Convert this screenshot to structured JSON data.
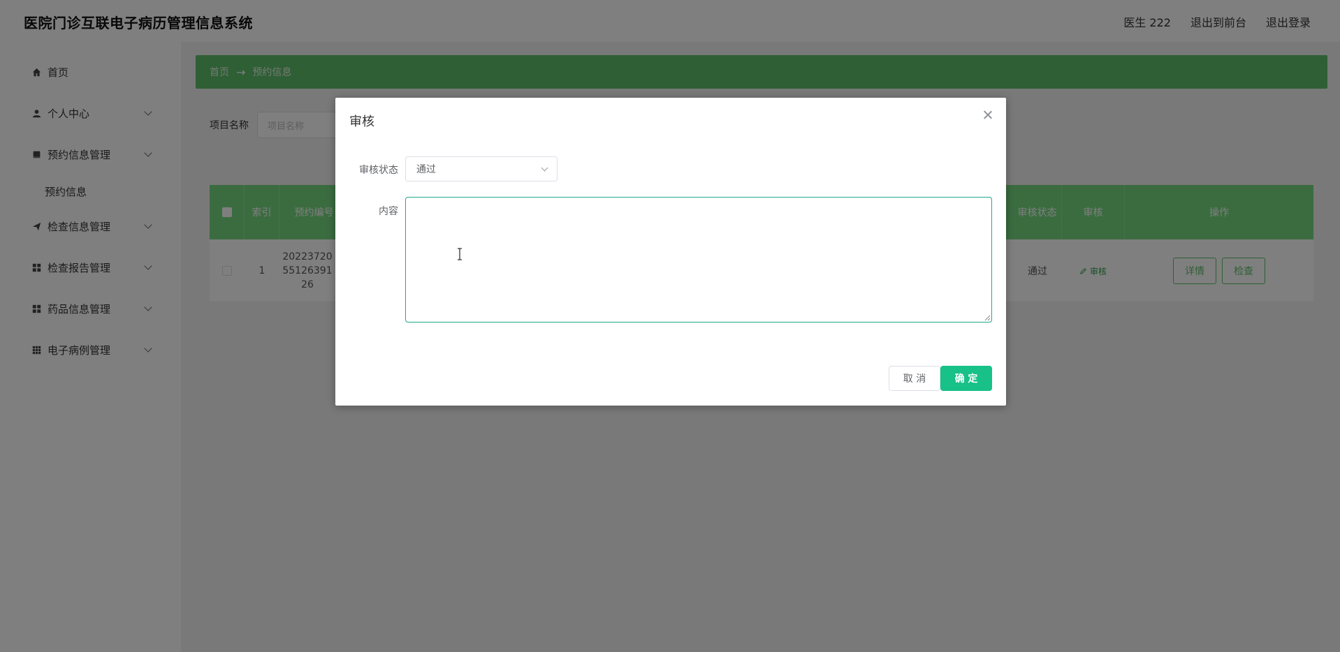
{
  "header": {
    "title": "医院门诊互联电子病历管理信息系统",
    "user": "医生 222",
    "to_frontend": "退出到前台",
    "logout": "退出登录"
  },
  "sidebar": {
    "items": [
      {
        "label": "首页",
        "icon": "home-icon"
      },
      {
        "label": "个人中心",
        "icon": "user-icon"
      },
      {
        "label": "预约信息管理",
        "icon": "book-icon"
      },
      {
        "label": "检查信息管理",
        "icon": "send-icon"
      },
      {
        "label": "检查报告管理",
        "icon": "grid-icon"
      },
      {
        "label": "药品信息管理",
        "icon": "grid-icon"
      },
      {
        "label": "电子病例管理",
        "icon": "apps-icon"
      }
    ],
    "submenu": "预约信息"
  },
  "breadcrumb": {
    "home": "首页",
    "arrow": "→",
    "current": "预约信息"
  },
  "search": {
    "label": "项目名称",
    "placeholder": "项目名称"
  },
  "table": {
    "headers": {
      "index": "索引",
      "number": "预约编号",
      "status": "审核状态",
      "audit": "审核",
      "actions": "操作"
    },
    "row": {
      "index": "1",
      "number": "20223720 55126391 26",
      "status": "通过",
      "audit_link": "审核",
      "detail_btn": "详情",
      "check_btn": "检查"
    }
  },
  "dialog": {
    "title": "审核",
    "status_label": "审核状态",
    "status_value": "通过",
    "content_label": "内容",
    "content_value": "",
    "cancel": "取 消",
    "ok": "确 定"
  },
  "colors": {
    "accent": "#5fbf6b",
    "table_header": "#77d880",
    "confirm": "#17c188",
    "focus_border": "#1fa88a"
  }
}
